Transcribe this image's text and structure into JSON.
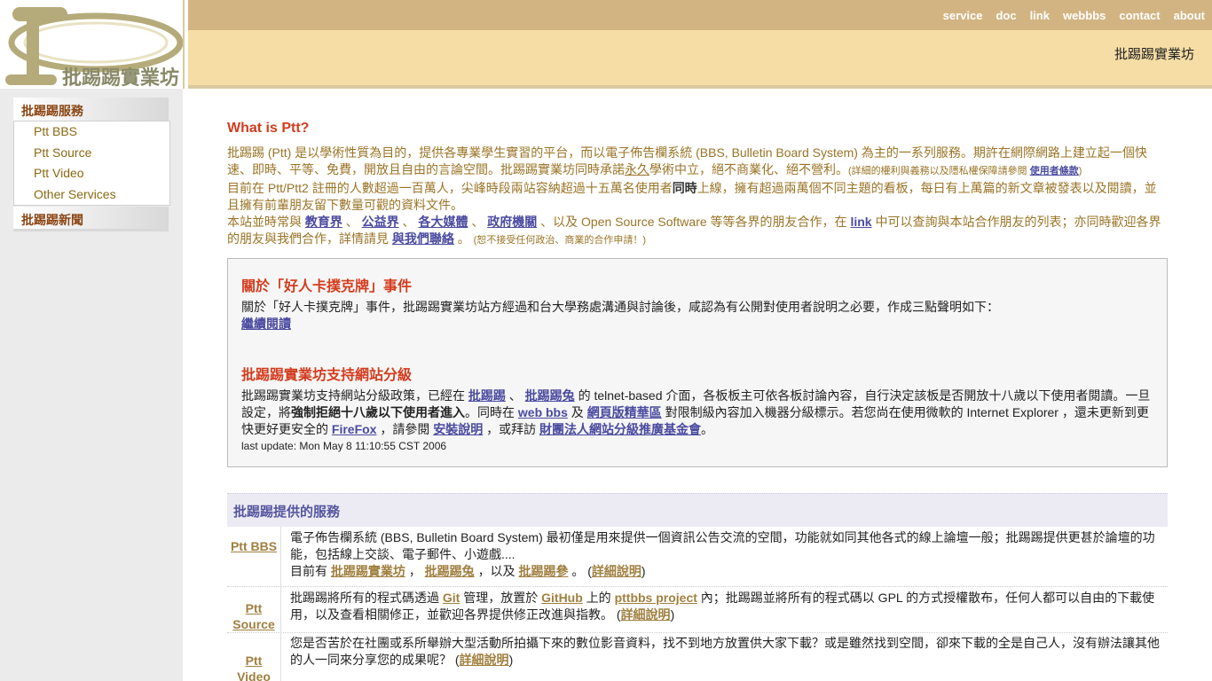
{
  "header": {
    "logo_text": "批踢踢實業坊",
    "nav": [
      "service",
      "doc",
      "link",
      "webbbs",
      "contact",
      "about"
    ],
    "site_name": "批踢踢實業坊"
  },
  "sidebar": {
    "services_title": "批踢踢服務",
    "items": [
      "Ptt BBS",
      "Ptt Source",
      "Ptt Video",
      "Other Services"
    ],
    "news_title": "批踢踢新聞"
  },
  "intro": {
    "title": "What is Ptt?",
    "p1a": "批踢踢 (Ptt) 是以學術性質為目的，提供各專業學生實習的平台，而以電子佈告欄系統 (BBS, Bulletin Board System) 為主的一系列服務。期許在網際網路上建立起一個快速、即時、平等、免費，開放且自由的言論空間。批踢踢實業坊同時承諾",
    "p1_yongjiu": "永久",
    "p1b": "學術中立，絕不商業化、絕不營利。",
    "p1_small": "(詳細的權利與義務以及隱私權保障請參閱",
    "p1_link": "使用者條款",
    "p1_small_end": ")",
    "p2a": "目前在 Ptt/Ptt2 註冊的人數超過一百萬人，尖峰時段兩站容納超過十五萬名使用者",
    "p2_bold": "同時",
    "p2b": "上線，擁有超過兩萬個不同主題的看板，每日有上萬篇的新文章被發表以及閱讀，並且擁有前輩朋友留下數量可觀的資料文件。",
    "p3a": "本站並時常與",
    "p3_links": [
      "教育界",
      "公益界",
      "各大媒體",
      "政府機關"
    ],
    "p3b": "、以及 Open Source Software 等等各界的朋友合作，在",
    "p3_link": "link",
    "p3c": "中可以查詢與本站合作朋友的列表；亦同時歡迎各界的朋友與我們合作，詳情請見",
    "p3_contact": "與我們聯絡",
    "p3d": "。",
    "p3_small": "(恕不接受任何政治、商業的合作申請！)"
  },
  "news": {
    "n1_title": "關於「好人卡撲克牌」事件",
    "n1_text": "關於「好人卡撲克牌」事件，批踢踢實業坊站方經過和台大學務處溝通與討論後，咸認為有公開對使用者說明之必要，作成三點聲明如下：",
    "n1_more": "繼續閱讀",
    "n2_title": "批踢踢實業坊支持網站分級",
    "n2_a": "批踢踢實業坊支持網站分級政策，已經在",
    "n2_l1": "批踢踢",
    "n2_l2": "批踢踢兔",
    "n2_b": "的 telnet-based 介面，各板板主可依各板討論內容，自行決定該板是否開放十八歲以下使用者閱讀。一旦設定，將",
    "n2_bold": "強制拒絕十八歲以下使用者進入",
    "n2_c": "。同時在",
    "n2_l3": "web bbs",
    "n2_and": "及",
    "n2_l4": "網頁版精華區",
    "n2_d": "對限制級內容加入機器分級標示。若您尚在使用微軟的 Internet Explorer ，還未更新到更快更好更安全的",
    "n2_l5": "FireFox",
    "n2_e": "，請參閱",
    "n2_l6": "安裝說明",
    "n2_f": "，或拜訪",
    "n2_l7": "財團法人網站分級推廣基金會",
    "n2_g": "。",
    "n2_update": "last update: Mon May 8 11:10:55 CST 2006"
  },
  "services": {
    "title": "批踢踢提供的服務",
    "bbs_name": "Ptt BBS",
    "bbs_text": "電子佈告欄系統 (BBS, Bulletin Board System) 最初僅是用來提供一個資訊公告交流的空間，功能就如同其他各式的線上論壇一般；批踢踢提供更甚於論壇的功能，包括線上交談、電子郵件、小遊戲....",
    "bbs_now": "目前有",
    "bbs_l1": "批踢踢實業坊",
    "bbs_l2": "批踢踢兔",
    "bbs_and": "，以及",
    "bbs_l3": "批踢踢參",
    "bbs_more": "詳細說明",
    "src_name1": "Ptt",
    "src_name2": "Source",
    "src_a": "批踢踢將所有的程式碼透過",
    "src_git": "Git",
    "src_b": "管理，放置於",
    "src_github": "GitHub",
    "src_c": "上的",
    "src_proj": "pttbbs project",
    "src_d": "內；批踢踢並將所有的程式碼以 GPL 的方式授權散布，任何人都可以自由的下載使用，以及查看相關修正，並歡迎各界提供修正改進與指教。",
    "src_more": "詳細說明",
    "vid_name1": "Ptt",
    "vid_name2": "Video",
    "vid_text": "您是否苦於在社團或系所舉辦大型活動所拍攝下來的數位影音資料，找不到地方放置供大家下載？或是雖然找到空間，卻來下載的全是自己人，沒有辦法讓其他的人一同來分享您的成果呢？",
    "vid_more": "詳細說明"
  },
  "colors": {
    "topbar": "#d2b483",
    "sitebar": "#f5dda5",
    "accent_red": "#d33c1e",
    "link_blue": "#4a4aa0",
    "link_brown": "#a08040"
  }
}
